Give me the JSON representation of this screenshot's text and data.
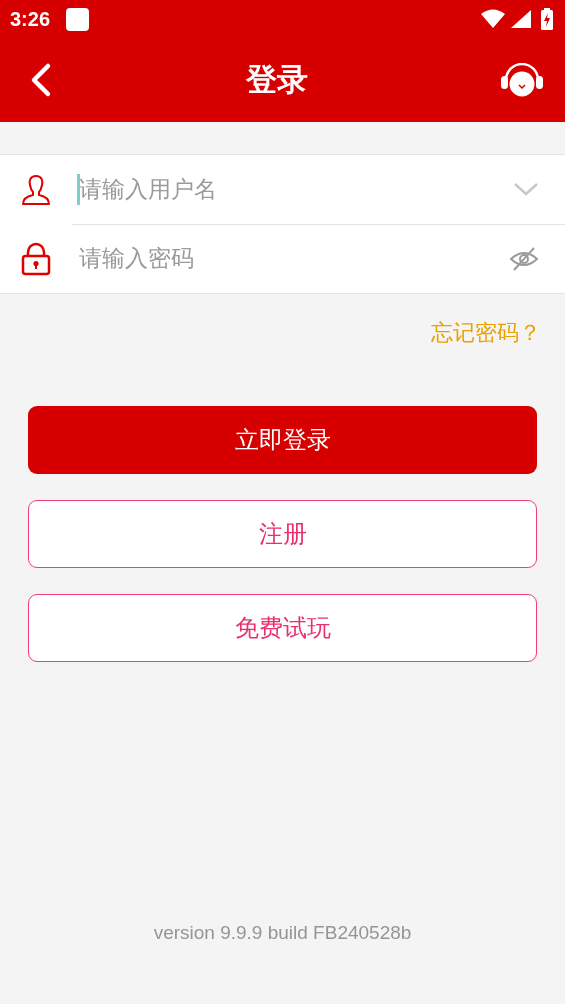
{
  "status_bar": {
    "time": "3:26"
  },
  "header": {
    "title": "登录"
  },
  "fields": [
    {
      "kind": "username",
      "placeholder": "请输入用户名",
      "focused": true
    },
    {
      "kind": "password",
      "placeholder": "请输入密码",
      "focused": false
    }
  ],
  "forgot_link": "忘记密码？",
  "buttons": [
    {
      "label": "立即登录",
      "kind": "primary"
    },
    {
      "label": "注册",
      "kind": "outline"
    },
    {
      "label": "免费试玩",
      "kind": "outline"
    }
  ],
  "version": "version 9.9.9 build FB240528b"
}
